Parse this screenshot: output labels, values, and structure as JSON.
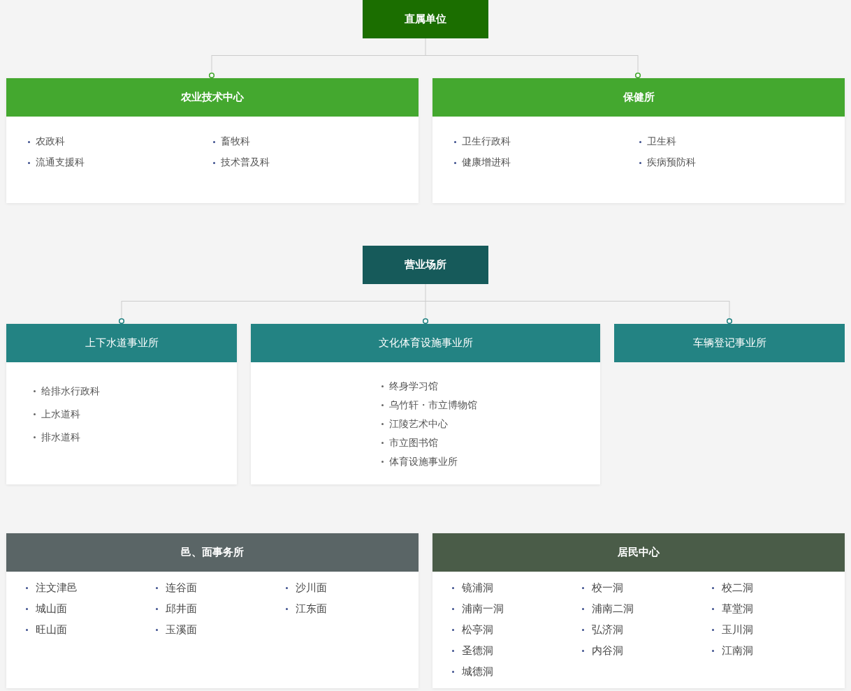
{
  "sections": [
    {
      "kind": "tree",
      "title": "直属单位",
      "units": [
        {
          "title": "农业技术中心",
          "rows": [
            [
              "农政科",
              "畜牧科"
            ],
            [
              "流通支援科",
              "技术普及科"
            ]
          ]
        },
        {
          "title": "保健所",
          "rows": [
            [
              "卫生行政科",
              "卫生科"
            ],
            [
              "健康增进科",
              "疾病预防科"
            ]
          ]
        }
      ]
    },
    {
      "kind": "tree",
      "title": "营业场所",
      "units": [
        {
          "title": "上下水道事业所",
          "rows": [
            [
              "给排水行政科"
            ],
            [
              "上水道科"
            ],
            [
              "排水道科"
            ]
          ]
        },
        {
          "title": "文化体育设施事业所",
          "rows": [
            [
              "终身学习馆"
            ],
            [
              "乌竹轩・市立博物馆"
            ],
            [
              "江陵艺术中心"
            ],
            [
              "市立图书馆"
            ],
            [
              "体育设施事业所"
            ]
          ]
        },
        {
          "title": "车辆登记事业所"
        }
      ]
    },
    {
      "kind": "group",
      "units": [
        {
          "title": "邑、面事务所",
          "rows": [
            [
              "注文津邑",
              "连谷面",
              "沙川面"
            ],
            [
              "城山面",
              "邱井面",
              "江东面"
            ],
            [
              "旺山面",
              "玉溪面"
            ]
          ]
        },
        {
          "title": "居民中心",
          "rows": [
            [
              "镜浦洞",
              "校一洞",
              "校二洞"
            ],
            [
              "浦南一洞",
              "浦南二洞",
              "草堂洞"
            ],
            [
              "松亭洞",
              "弘济洞",
              "玉川洞"
            ],
            [
              "圣德洞",
              "内谷洞",
              "江南洞"
            ],
            [
              "城德洞"
            ]
          ]
        }
      ]
    }
  ]
}
